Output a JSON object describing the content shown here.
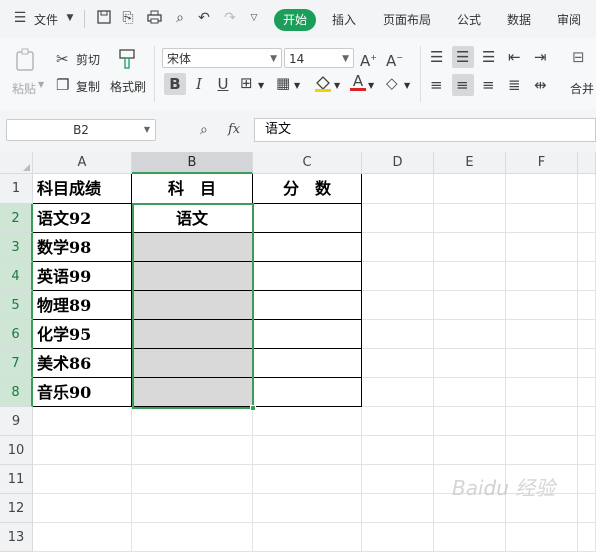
{
  "menubar": {
    "file_label": "文件",
    "tabs": [
      "开始",
      "插入",
      "页面布局",
      "公式",
      "数据",
      "审阅"
    ]
  },
  "ribbon": {
    "paste": "粘贴",
    "cut": "剪切",
    "copy": "复制",
    "format_painter": "格式刷",
    "font_name": "宋体",
    "font_size": "14",
    "merge": "合并"
  },
  "formula_bar": {
    "name_box": "B2",
    "fx": "fx",
    "content": "语文"
  },
  "sheet": {
    "columns": [
      "A",
      "B",
      "C",
      "D",
      "E",
      "F"
    ],
    "rows": [
      "1",
      "2",
      "3",
      "4",
      "5",
      "6",
      "7",
      "8",
      "9",
      "10",
      "11",
      "12",
      "13"
    ],
    "selected_column": "B",
    "cells": {
      "A1": "科目成绩",
      "B1": "科　目",
      "C1": "分　数",
      "A2": "语文92",
      "B2": "语文",
      "A3": "数学98",
      "A4": "英语99",
      "A5": "物理89",
      "A6": "化学95",
      "A7": "美术86",
      "A8": "音乐90"
    }
  },
  "colors": {
    "accent": "#1a9e5a",
    "selection_border": "#3a9d5a",
    "fill_gray": "#d9d9d9"
  },
  "icons": [
    "menu-icon",
    "save-icon",
    "print-icon",
    "undo-icon",
    "redo-icon",
    "cut-icon",
    "copy-icon",
    "paint-brush-icon",
    "bold-icon",
    "italic-icon",
    "underline-icon",
    "border-icon",
    "fill-color-icon",
    "font-color-icon",
    "eraser-icon",
    "zoom-icon",
    "align-icons"
  ]
}
